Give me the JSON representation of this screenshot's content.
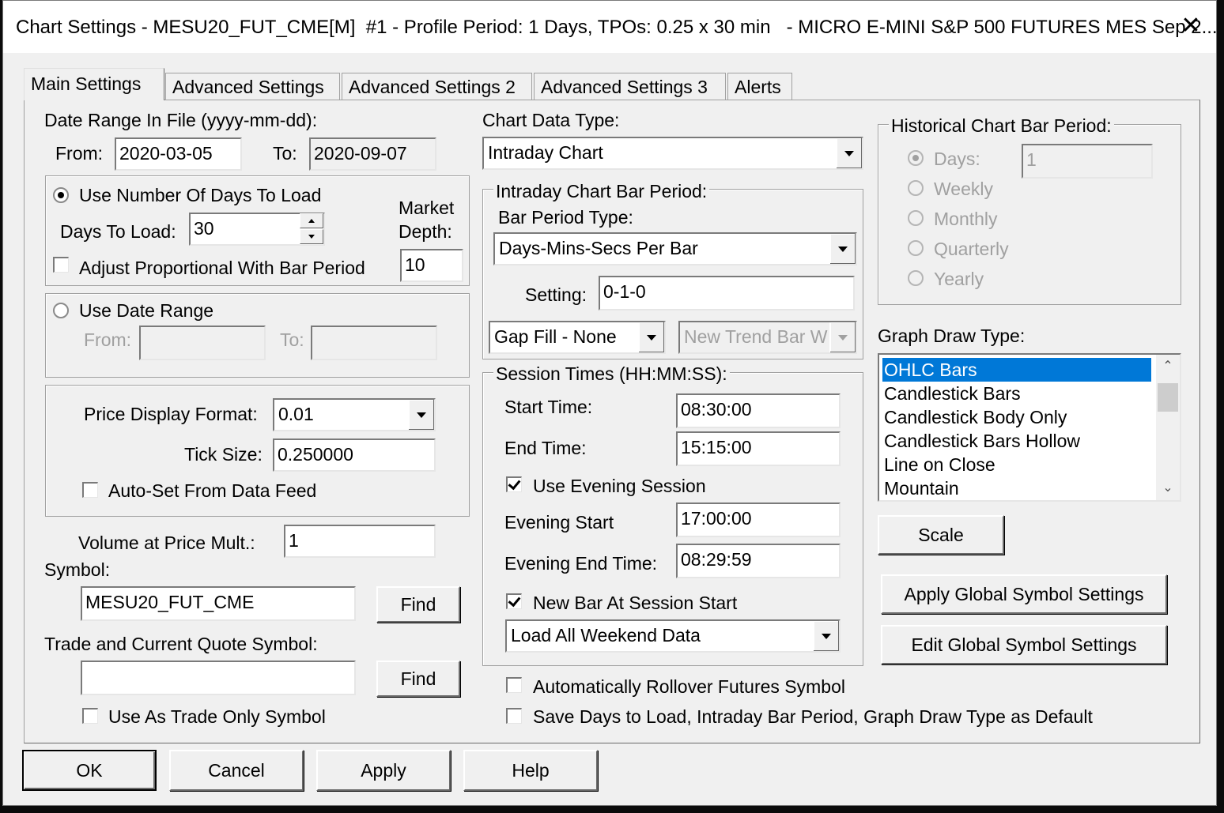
{
  "window": {
    "title": "Chart Settings - MESU20_FUT_CME[M]  #1 - Profile Period: 1 Days, TPOs: 0.25 x 30 min   - MICRO E-MINI S&P 500 FUTURES MES Sep 2...",
    "close_glyph": "✕"
  },
  "tabs": [
    {
      "label": "Main Settings",
      "active": true
    },
    {
      "label": "Advanced Settings"
    },
    {
      "label": "Advanced Settings 2"
    },
    {
      "label": "Advanced Settings 3"
    },
    {
      "label": "Alerts"
    }
  ],
  "date_range": {
    "heading": "Date Range In File (yyyy-mm-dd):",
    "from_label": "From:",
    "from_value": "2020-03-05",
    "to_label": "To:",
    "to_value": "2020-09-07"
  },
  "days_group": {
    "use_days_label": "Use Number Of Days To Load",
    "use_days_selected": true,
    "days_label": "Days To Load:",
    "days_value": "30",
    "market_depth_label_1": "Market",
    "market_depth_label_2": "Depth:",
    "market_depth_value": "10",
    "adjust_label": "Adjust Proportional With Bar Period",
    "adjust_checked": false
  },
  "date_range_group": {
    "use_range_label": "Use Date Range",
    "from_label": "From:",
    "from_value": "",
    "to_label": "To:",
    "to_value": ""
  },
  "price_group": {
    "format_label": "Price Display Format:",
    "format_value": "0.01",
    "tick_label": "Tick Size:",
    "tick_value": "0.250000",
    "auto_label": "Auto-Set From Data Feed",
    "auto_checked": false
  },
  "volume": {
    "label": "Volume at Price Mult.:",
    "value": "1"
  },
  "symbol": {
    "label": "Symbol:",
    "value": "MESU20_FUT_CME",
    "find_label": "Find"
  },
  "trade_symbol": {
    "label": "Trade and Current Quote Symbol:",
    "value": "",
    "find_label": "Find",
    "trade_only_label": "Use As Trade Only Symbol",
    "trade_only_checked": false
  },
  "chart_data_type": {
    "label": "Chart Data Type:",
    "value": "Intraday Chart"
  },
  "intraday_group": {
    "legend": "Intraday Chart Bar Period:",
    "type_label": "Bar Period Type:",
    "type_value": "Days-Mins-Secs Per Bar",
    "setting_label": "Setting:",
    "setting_value": "0-1-0",
    "gap_fill_value": "Gap Fill - None",
    "new_trend_value": "New Trend Bar W"
  },
  "session_group": {
    "legend": "Session Times (HH:MM:SS):",
    "start_label": "Start Time:",
    "start_value": "08:30:00",
    "end_label": "End Time:",
    "end_value": "15:15:00",
    "evening_label": "Use Evening Session",
    "evening_checked": true,
    "evening_start_label": "Evening Start",
    "evening_start_value": "17:00:00",
    "evening_end_label": "Evening End Time:",
    "evening_end_value": "08:29:59",
    "new_bar_label": "New Bar At Session Start",
    "new_bar_checked": true,
    "weekend_value": "Load All Weekend Data"
  },
  "rollover": {
    "label": "Automatically Rollover Futures Symbol",
    "checked": false
  },
  "save_default": {
    "label": "Save Days to Load, Intraday Bar Period, Graph Draw Type as Default",
    "checked": false
  },
  "historical_group": {
    "legend": "Historical Chart Bar Period:",
    "days_label": "Days:",
    "days_value": "1",
    "weekly_label": "Weekly",
    "monthly_label": "Monthly",
    "quarterly_label": "Quarterly",
    "yearly_label": "Yearly"
  },
  "graph_draw": {
    "label": "Graph Draw Type:",
    "items": [
      "OHLC Bars",
      "Candlestick Bars",
      "Candlestick Body Only",
      "Candlestick Bars Hollow",
      "Line on Close",
      "Mountain"
    ],
    "selected": "OHLC Bars"
  },
  "right_buttons": {
    "scale": "Scale",
    "apply_global": "Apply Global Symbol Settings",
    "edit_global": "Edit Global Symbol Settings"
  },
  "footer_buttons": {
    "ok": "OK",
    "cancel": "Cancel",
    "apply": "Apply",
    "help": "Help"
  },
  "colors": {
    "dialog_bg": "#f0f0f0",
    "selection": "#0078d7",
    "backdrop": "#0b0b0b"
  }
}
